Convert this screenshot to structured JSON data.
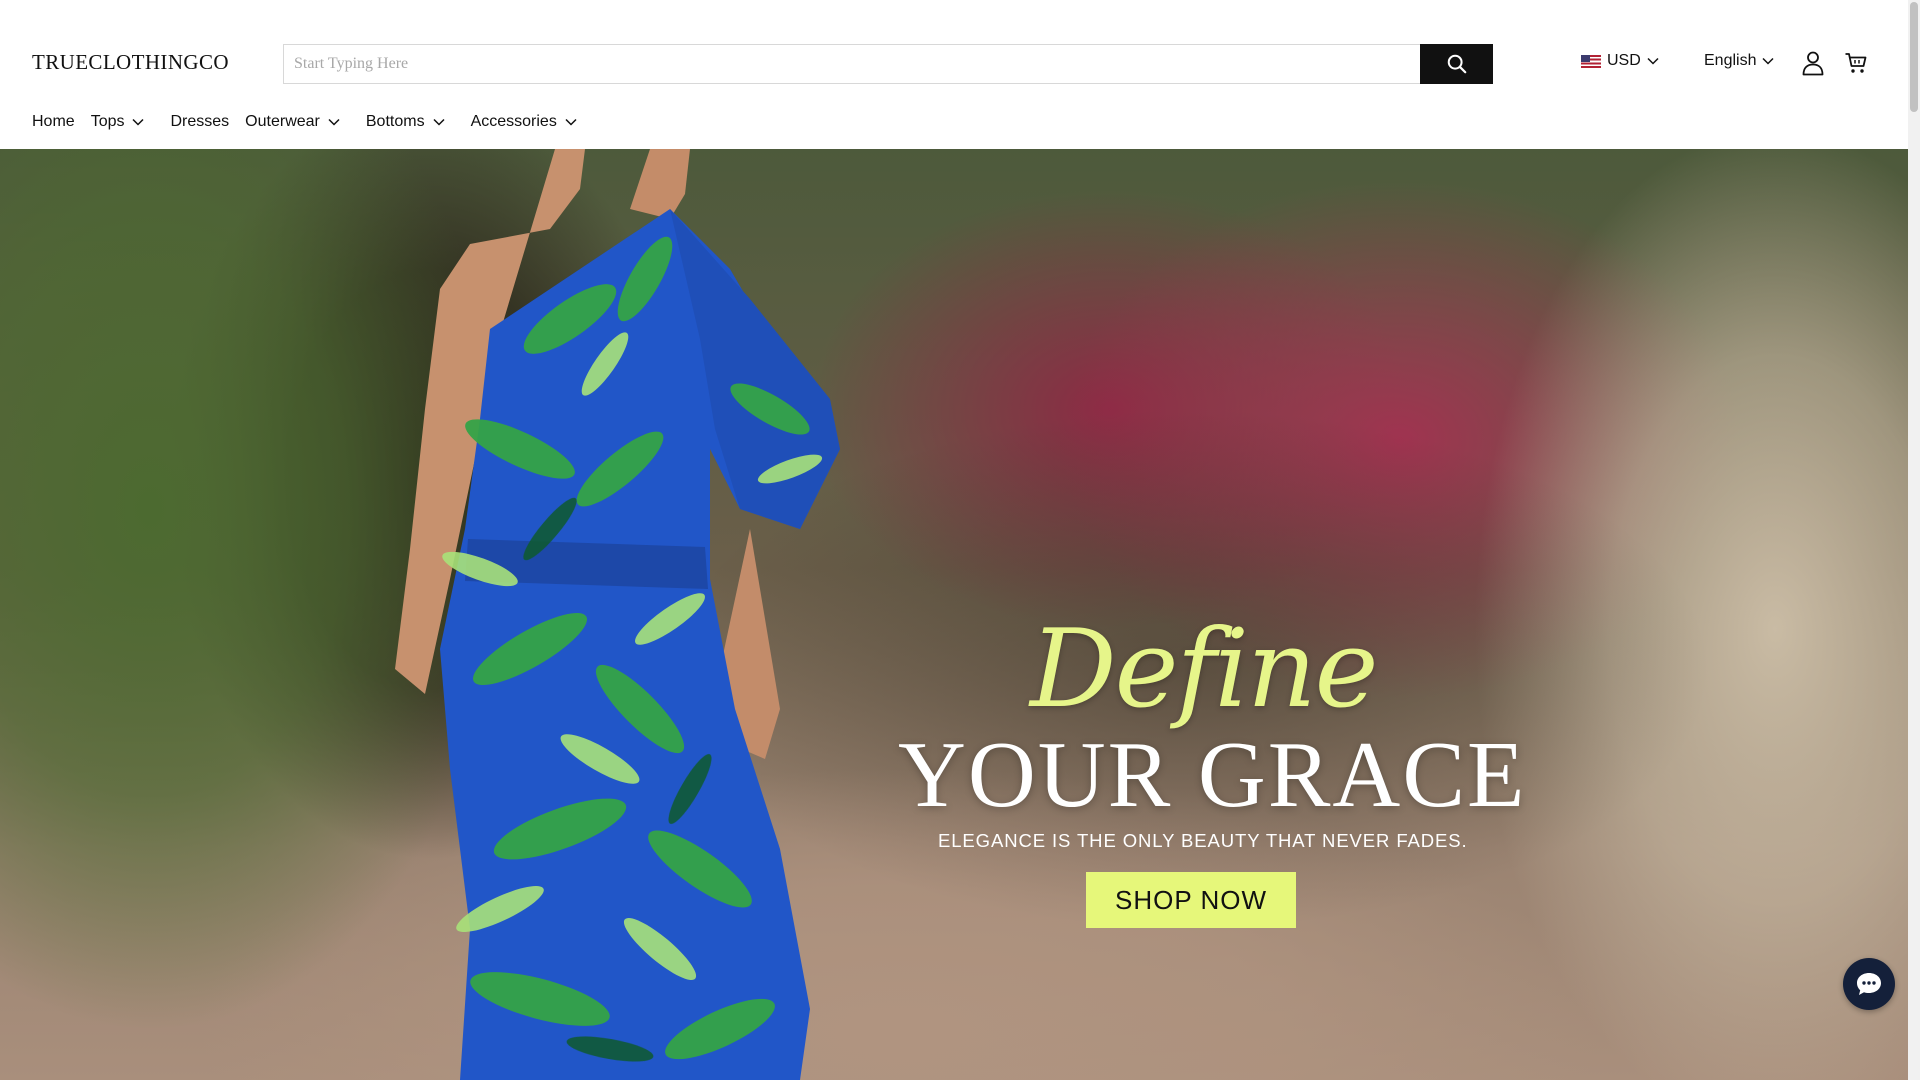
{
  "header": {
    "logo": "TRUECLOTHINGCO",
    "search": {
      "placeholder": "Start Typing Here",
      "value": ""
    },
    "currency": {
      "label": "USD",
      "flag": "us-flag-icon"
    },
    "language": {
      "label": "English"
    }
  },
  "nav": {
    "items": [
      {
        "label": "Home",
        "has_dropdown": false
      },
      {
        "label": "Tops",
        "has_dropdown": true
      },
      {
        "label": "Dresses",
        "has_dropdown": false
      },
      {
        "label": "Outerwear",
        "has_dropdown": true
      },
      {
        "label": "Bottoms",
        "has_dropdown": true
      },
      {
        "label": "Accessories",
        "has_dropdown": true
      }
    ]
  },
  "hero": {
    "script_text": "Define",
    "title": "YOUR GRACE",
    "subtitle": "ELEGANCE IS THE ONLY BEAUTY THAT NEVER FADES.",
    "cta_label": "SHOP NOW"
  },
  "icons": [
    "search-icon",
    "us-flag-icon",
    "chevron-down-icon",
    "account-icon",
    "cart-icon",
    "chat-icon"
  ],
  "colors": {
    "accent": "#e6f77a",
    "script": "#e6f58a",
    "search_button": "#111111",
    "chat_button": "#14203a",
    "dress_blue": "#2156c8",
    "leaf_green": "#2f8f3e"
  }
}
